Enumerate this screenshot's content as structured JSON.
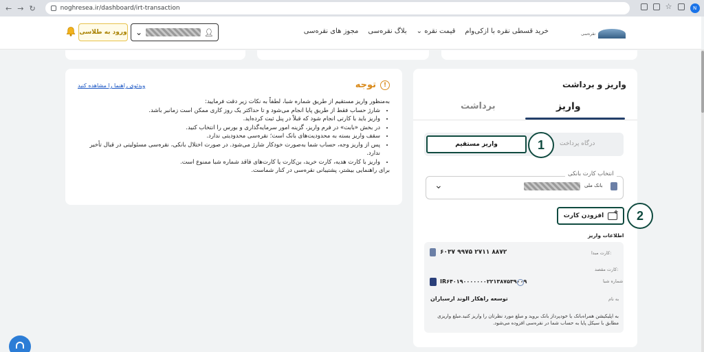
{
  "browser": {
    "url": "noghresea.ir/dashboard/irt-transaction",
    "profile_initial": "N"
  },
  "header": {
    "logo_text": "نقره‌سی",
    "nav": [
      "خرید قسطی نقره با ازکی‌وام",
      "قیمت نقره",
      "بلاگ نقره‌سی",
      "مجوز های نقره‌سی"
    ],
    "login_label": "ورود به طلاسی"
  },
  "notice": {
    "title": "توجه",
    "video_link": "ویدئوی راهنما را مشاهده کنید",
    "intro": "به‌منظور واریز مستقیم از طریق شماره شبا، لطفاً به نکات زیر دقت فرمایید:",
    "items": [
      "شارژ حساب فقط از طریق پایا انجام می‌شود و تا حداکثر یک روز کاری ممکن است زمانبر باشد.",
      "واریز باید با کارتی انجام شود که قبلاً در پنل ثبت کرده‌اید.",
      "در بخش «بابت» در فرم واریز، گزینه امور سرمایه‌گذاری و بورس را انتخاب کنید.",
      "سقف واریز بسته به محدودیت‌های بانک است؛ نقره‌سی محدودیتی ندارد.",
      "پس از واریز وجه، حساب شما به‌صورت خودکار شارژ می‌شود. در صورت اختلال بانکی، نقره‌سی مسئولیتی در قبال تأخیر ندارد.",
      "واریز با کارت هدیه، کارت خرید، بن‌کارت یا کارت‌های فاقد شماره شبا ممنوع است."
    ],
    "outro": "برای راهنمایی بیشتر، پشتیبانی نقره‌سی در کنار شماست."
  },
  "deposit": {
    "title": "واریز و برداشت",
    "tab_deposit": "واریز",
    "tab_withdraw": "برداشت",
    "gateway_label": "درگاه پرداخت",
    "direct_label": "واریز مستقیم",
    "step1": "1",
    "step2": "2",
    "card_select_label": "انتخاب کارت بانکی",
    "bank_name": "بانک ملی",
    "add_card_label": "افزودن کارت",
    "info_title": "اطلاعات واریز",
    "origin_label": "کارت مبدا:",
    "origin_value": "۶۰۳۷ ۹۹۷۵ ۲۷۱۱ ۸۸۷۲",
    "dest_label": "کارت مقصد:",
    "sheba_label": "شماره شبا",
    "sheba_value": "IR۶۴۰۱۹۰۰۰۰۰۰۰۲۲۱۳۸۷۵۳۹۰۰۹",
    "holder_label": "به نام",
    "holder_value": "توسعه راهکار الوند ارسباران",
    "desc": "به اپلیکیشن همراه‌بانک یا خودپرداز بانک بروید و مبلغ مورد نظرتان را واریز کنید.مبلغ واریزی مطابق با سیکل پایا به حساب شما در نقره‌سی افزوده می‌شود."
  }
}
